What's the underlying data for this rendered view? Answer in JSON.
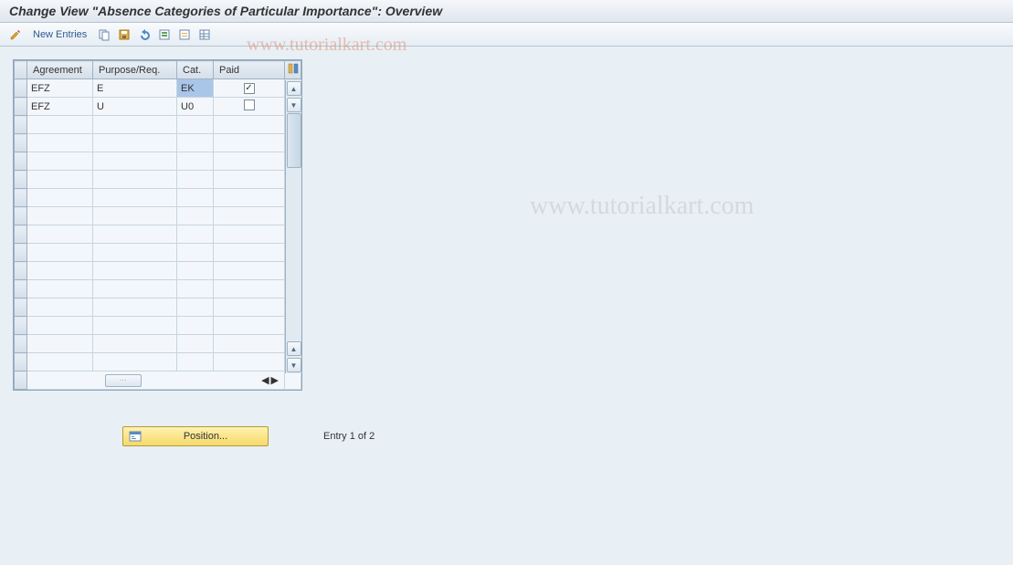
{
  "title": "Change View \"Absence Categories of Particular Importance\": Overview",
  "toolbar": {
    "new_entries_label": "New Entries",
    "icons": {
      "edit": "edit-pencil-icon",
      "copy": "copy-icon",
      "save": "save-icon",
      "undo": "undo-icon",
      "select_all": "select-all-icon",
      "delimit": "delimit-icon",
      "table_settings": "table-settings-icon"
    }
  },
  "table": {
    "headers": {
      "agreement": "Agreement",
      "purpose": "Purpose/Req.",
      "cat": "Cat.",
      "paid": "Paid"
    },
    "rows": [
      {
        "agreement": "EFZ",
        "purpose": "E",
        "cat": "EK",
        "paid": true,
        "cat_selected": true
      },
      {
        "agreement": "EFZ",
        "purpose": "U",
        "cat": "U0",
        "paid": false,
        "cat_selected": false
      }
    ],
    "empty_rows": 14
  },
  "footer": {
    "position_label": "Position...",
    "entry_text": "Entry 1 of 2"
  },
  "watermark": "www.tutorialkart.com",
  "watermark2": "www.tutorialkart.com"
}
